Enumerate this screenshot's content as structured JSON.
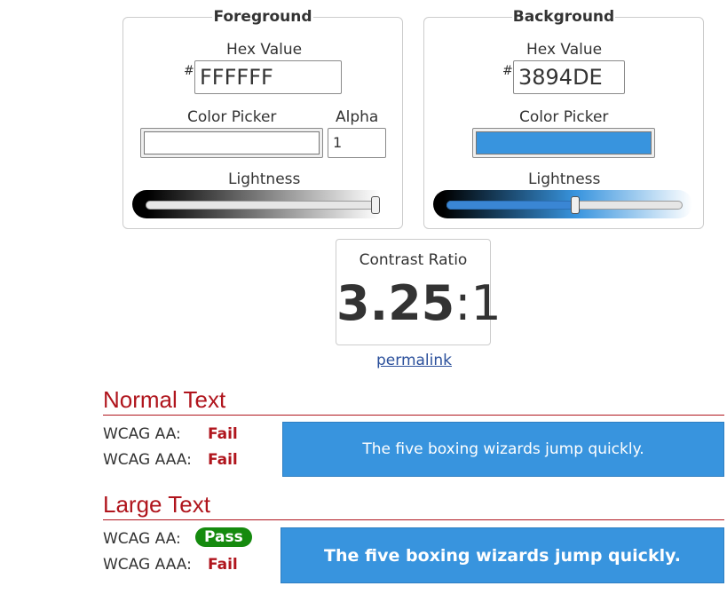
{
  "foreground": {
    "legend": "Foreground",
    "hex_label": "Hex Value",
    "hash": "#",
    "hex_value": "FFFFFF",
    "picker_label": "Color Picker",
    "alpha_label": "Alpha",
    "alpha_value": "1",
    "lightness_label": "Lightness",
    "color": "#FFFFFF",
    "lightness_percent": 100
  },
  "background": {
    "legend": "Background",
    "hex_label": "Hex Value",
    "hash": "#",
    "hex_value": "3894DE",
    "picker_label": "Color Picker",
    "lightness_label": "Lightness",
    "color": "#3894DE",
    "lightness_percent": 54
  },
  "contrast": {
    "label": "Contrast Ratio",
    "ratio_main": "3.25",
    "ratio_suffix": ":1",
    "permalink": "permalink"
  },
  "normal_text": {
    "title": "Normal Text",
    "aa_label": "WCAG AA:",
    "aa_result": "Fail",
    "aaa_label": "WCAG AAA:",
    "aaa_result": "Fail",
    "sample": "The five boxing wizards jump quickly."
  },
  "large_text": {
    "title": "Large Text",
    "aa_label": "WCAG AA:",
    "aa_result": "Pass",
    "aaa_label": "WCAG AAA:",
    "aaa_result": "Fail",
    "sample": "The five boxing wizards jump quickly."
  },
  "colors": {
    "fail": "#B0151D",
    "pass_badge": "#158A0E",
    "sample_bg": "#3894DE",
    "link": "#2A4F9B"
  }
}
